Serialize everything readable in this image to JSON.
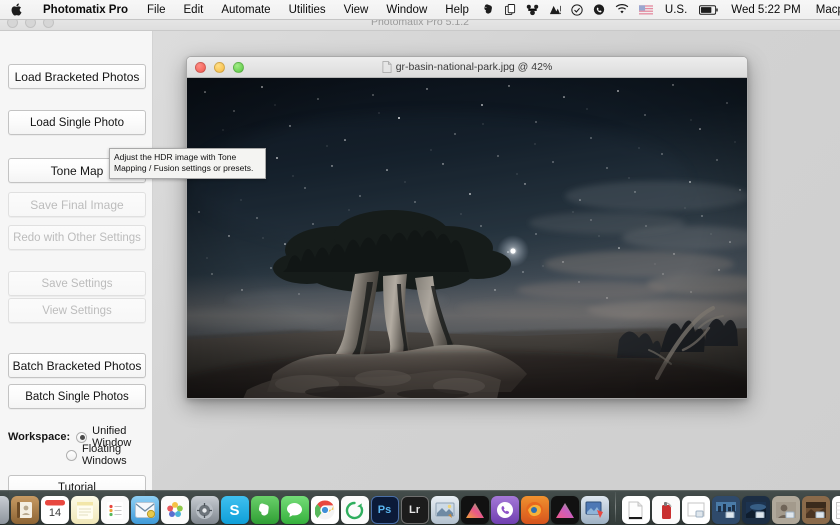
{
  "menubar": {
    "apple_icon": "apple-logo-icon",
    "app_name": "Photomatix Pro",
    "menus": [
      "File",
      "Edit",
      "Automate",
      "Utilities",
      "View",
      "Window",
      "Help"
    ],
    "status_icons": [
      "evernote-icon",
      "duplicate-icon",
      "dropbox-sync-icon",
      "istat-menus-icon",
      "checkmark-circle-icon",
      "viber-icon",
      "wifi-icon"
    ],
    "input_source_flag": "us-flag-icon",
    "input_source_label": "U.S.",
    "battery_icon": "battery-icon",
    "clock": "Wed 5:22 PM",
    "user_name": "Macphun",
    "search_icon": "search-icon",
    "notification_center_icon": "list-lines-icon"
  },
  "main_window": {
    "title": "Photomatix Pro 5.1.2",
    "traffic_lights": [
      "close-button",
      "minimize-button",
      "zoom-button"
    ]
  },
  "sidebar": {
    "buttons": [
      {
        "label": "Load Bracketed Photos",
        "disabled": false,
        "name": "load-bracketed-photos-button"
      },
      {
        "label": "Load Single Photo",
        "disabled": false,
        "name": "load-single-photo-button"
      },
      {
        "label": "Tone Map",
        "disabled": false,
        "name": "tone-map-button"
      },
      {
        "label": "Save Final Image",
        "disabled": true,
        "name": "save-final-image-button"
      },
      {
        "label": "Redo with Other Settings",
        "disabled": true,
        "name": "redo-with-other-settings-button"
      },
      {
        "label": "Save Settings",
        "disabled": true,
        "name": "save-settings-button"
      },
      {
        "label": "View Settings",
        "disabled": true,
        "name": "view-settings-button"
      },
      {
        "label": "Batch Bracketed Photos",
        "disabled": false,
        "name": "batch-bracketed-photos-button"
      },
      {
        "label": "Batch Single Photos",
        "disabled": false,
        "name": "batch-single-photos-button"
      }
    ],
    "workspace": {
      "label": "Workspace:",
      "options": [
        {
          "label": "Unified Window",
          "selected": true
        },
        {
          "label": "Floating Windows",
          "selected": false
        }
      ]
    },
    "tutorial_label": "Tutorial"
  },
  "tooltip": {
    "text": "Adjust the HDR image with Tone Mapping / Fusion settings or presets."
  },
  "image_window": {
    "title": "gr-basin-national-park.jpg @ 42%",
    "file_name": "gr-basin-national-park.jpg",
    "zoom_level": "42%",
    "doc_icon": "document-proxy-icon",
    "photo_description": "Bristlecone pine tree at night under a starry sky, Great Basin National Park"
  },
  "dock": {
    "items": [
      {
        "name": "finder",
        "glyph": "🙂",
        "color": "#3ba7e8",
        "running": true
      },
      {
        "name": "launchpad",
        "glyph": "🚀",
        "color": "#8d9299",
        "running": false
      },
      {
        "name": "contacts",
        "glyph": "📒",
        "color": "#b58b52",
        "running": false
      },
      {
        "name": "calendar",
        "glyph": "14",
        "color": "#ffffff",
        "running": false
      },
      {
        "name": "notes",
        "glyph": "📒",
        "color": "#f7e9a0",
        "running": false
      },
      {
        "name": "reminders",
        "glyph": "☰",
        "color": "#fbfbfb",
        "running": false
      },
      {
        "name": "mail",
        "glyph": "✉",
        "color": "#5ab3ef",
        "running": true
      },
      {
        "name": "photos",
        "glyph": "❁",
        "color": "#fafafa",
        "running": false
      },
      {
        "name": "system-preferences",
        "glyph": "⚙",
        "color": "#8d9299",
        "running": true
      },
      {
        "name": "skype",
        "glyph": "S",
        "color": "#19b3e8",
        "running": true
      },
      {
        "name": "evernote",
        "glyph": "🐘",
        "color": "#4bb543",
        "running": true
      },
      {
        "name": "messages",
        "glyph": "💬",
        "color": "#46c34a",
        "running": false
      },
      {
        "name": "chrome",
        "glyph": "◉",
        "color": "#e8453c",
        "running": true
      },
      {
        "name": "app-green-refresh",
        "glyph": "⟳",
        "color": "#2fb35f",
        "running": true
      },
      {
        "name": "photoshop",
        "glyph": "Ps",
        "color": "#0a1b3d",
        "running": true
      },
      {
        "name": "lightroom",
        "glyph": "Lr",
        "color": "#1a1a1a",
        "running": true
      },
      {
        "name": "photomatix",
        "glyph": "▣",
        "color": "#cfd8e2",
        "running": true
      },
      {
        "name": "aurora-hdr",
        "glyph": "▲",
        "color": "#e8508a",
        "running": true
      },
      {
        "name": "viber",
        "glyph": "☎",
        "color": "#8a5fc0",
        "running": true
      },
      {
        "name": "firefox",
        "glyph": "🦊",
        "color": "#e8681e",
        "running": true
      },
      {
        "name": "prism-app",
        "glyph": "▲",
        "color": "#cf5fa8",
        "running": true
      },
      {
        "name": "image-editor",
        "glyph": "▣",
        "color": "#4d78b5",
        "running": true
      }
    ],
    "files": [
      {
        "name": "document-stack",
        "glyph": "📄",
        "color": "#fafafa"
      },
      {
        "name": "red-utility-app",
        "glyph": "🧯",
        "color": "#cf3030"
      },
      {
        "name": "downloads-document",
        "glyph": "📄",
        "color": "#fafafa"
      },
      {
        "name": "city-photo-file",
        "glyph": "🏙",
        "color": "#5b86b5"
      },
      {
        "name": "sky-photo-file",
        "glyph": "🌅",
        "color": "#2f4a6b"
      },
      {
        "name": "portrait-photo-file",
        "glyph": "🖼",
        "color": "#b0a89a"
      },
      {
        "name": "landscape-photo-file",
        "glyph": "🖼",
        "color": "#8a6a4a"
      },
      {
        "name": "spreadsheet-file",
        "glyph": "▦",
        "color": "#f2f2f2"
      },
      {
        "name": "trash",
        "glyph": "🗑",
        "color": "#d8dde0"
      }
    ]
  }
}
